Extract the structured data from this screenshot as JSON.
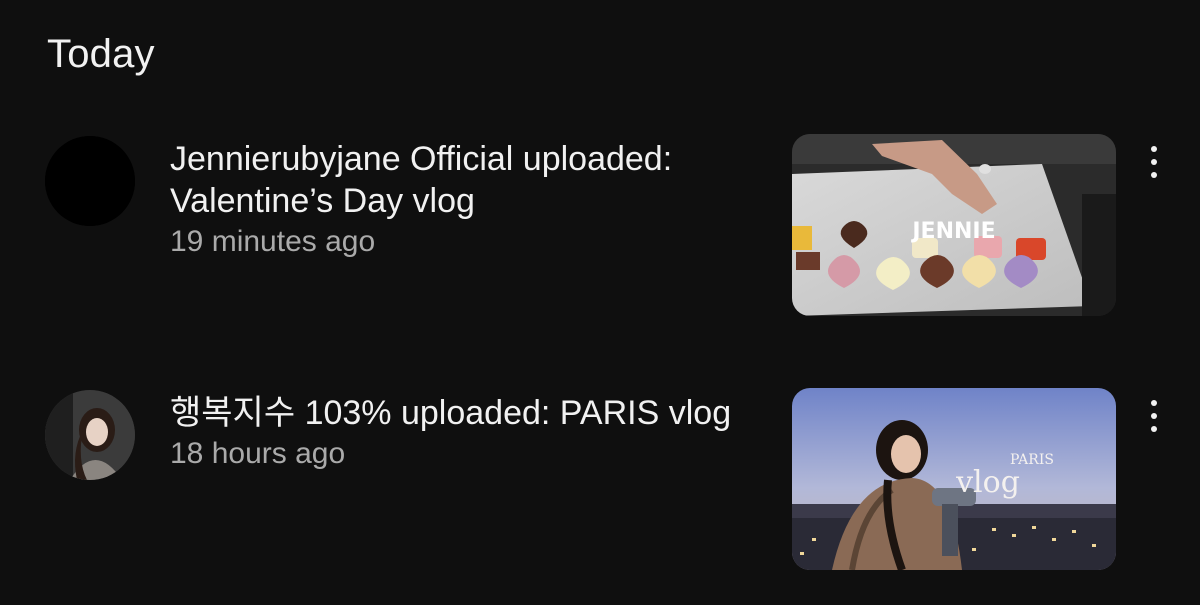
{
  "section": {
    "title": "Today"
  },
  "notifications": [
    {
      "title": "Jennierubyjane Official uploaded: Valentine’s Day vlog",
      "time": "19 minutes ago",
      "thumbnail_overlay": "JENNIE",
      "icon": "more-vert-icon"
    },
    {
      "title": "행복지수 103% uploaded: PARIS vlog",
      "time": "18 hours ago",
      "thumbnail_overlay_top": "PARIS",
      "thumbnail_overlay_bottom": "vlog",
      "icon": "more-vert-icon"
    }
  ],
  "colors": {
    "background": "#0f0f0f",
    "primary_text": "#f1f1f1",
    "secondary_text": "#aaaaaa"
  }
}
